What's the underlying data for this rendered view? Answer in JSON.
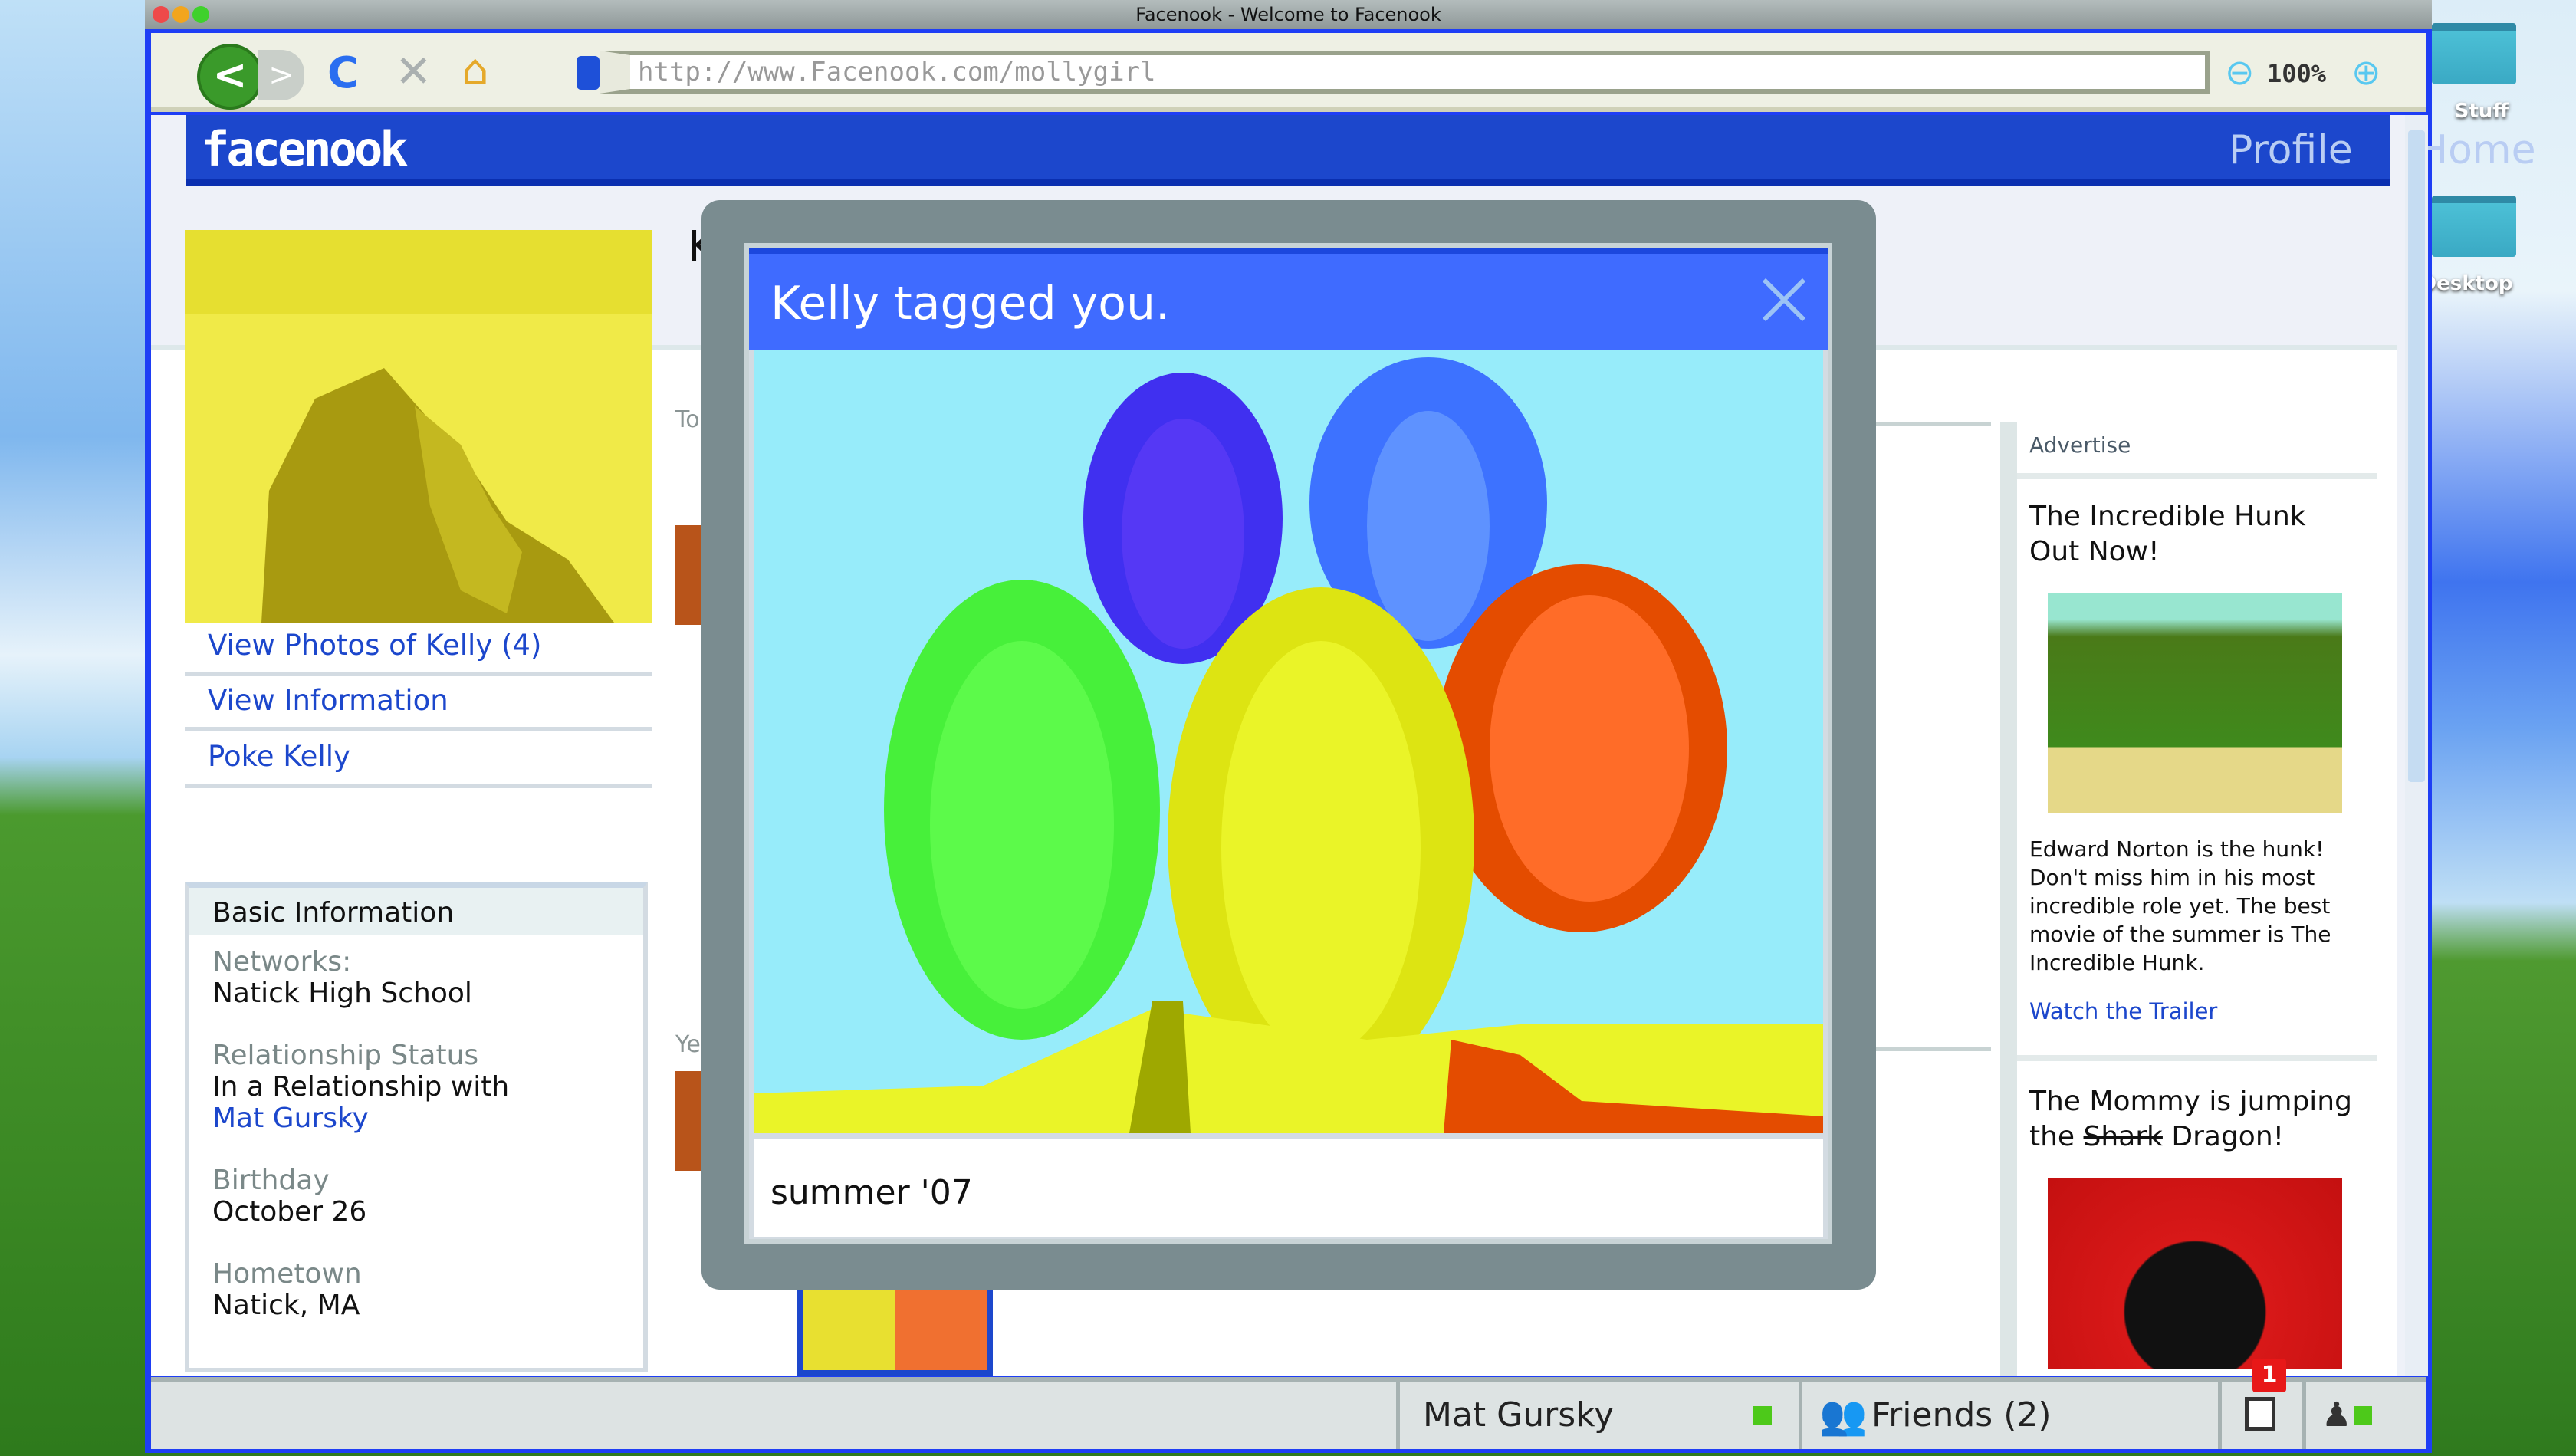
{
  "window": {
    "title": "Facenook - Welcome to Facenook"
  },
  "toolbar": {
    "url": "http://www.Facenook.com/mollygirl",
    "zoom": "100%"
  },
  "desktop": {
    "folders": [
      {
        "label": "Stuff"
      },
      {
        "label": "Desktop"
      }
    ]
  },
  "header": {
    "logo": "facenook",
    "nav": [
      {
        "label": "Profile"
      },
      {
        "label": "Home"
      }
    ]
  },
  "sidebar": {
    "links": [
      {
        "label": "View Photos of Kelly (4)"
      },
      {
        "label": "View Information"
      },
      {
        "label": "Poke Kelly"
      }
    ],
    "basic_info": {
      "title": "Basic Information",
      "fields": [
        {
          "label": "Networks:",
          "value": "Natick High School"
        },
        {
          "label": "Relationship Status",
          "value": "In a Relationship with",
          "link": "Mat Gursky"
        },
        {
          "label": "Birthday",
          "value": "October 26"
        },
        {
          "label": "Hometown",
          "value": "Natick, MA"
        }
      ]
    }
  },
  "feed": {
    "profile_name": "Kell",
    "today": "Today",
    "yesterday": "Yester"
  },
  "ads": {
    "heading": "Advertise",
    "items": [
      {
        "title": "The Incredible Hunk Out Now!",
        "body": "Edward Norton is the hunk! Don't miss him in his most incredible role yet. The best movie of the summer is The Incredible Hunk.",
        "link": "Watch the Trailer"
      },
      {
        "title_pre": "The Mommy is jumping the ",
        "title_struck": "Shark",
        "title_post": " Dragon!"
      }
    ]
  },
  "modal": {
    "title": "Kelly tagged you.",
    "caption": "summer '07"
  },
  "chatbar": {
    "contact": "Mat Gursky",
    "friends": "Friends (2)",
    "notifications": "1"
  },
  "colors": {
    "brand": "#1c47cc",
    "modal_header": "#3f6bff",
    "online": "#4dc91a",
    "badge": "#e81818"
  }
}
